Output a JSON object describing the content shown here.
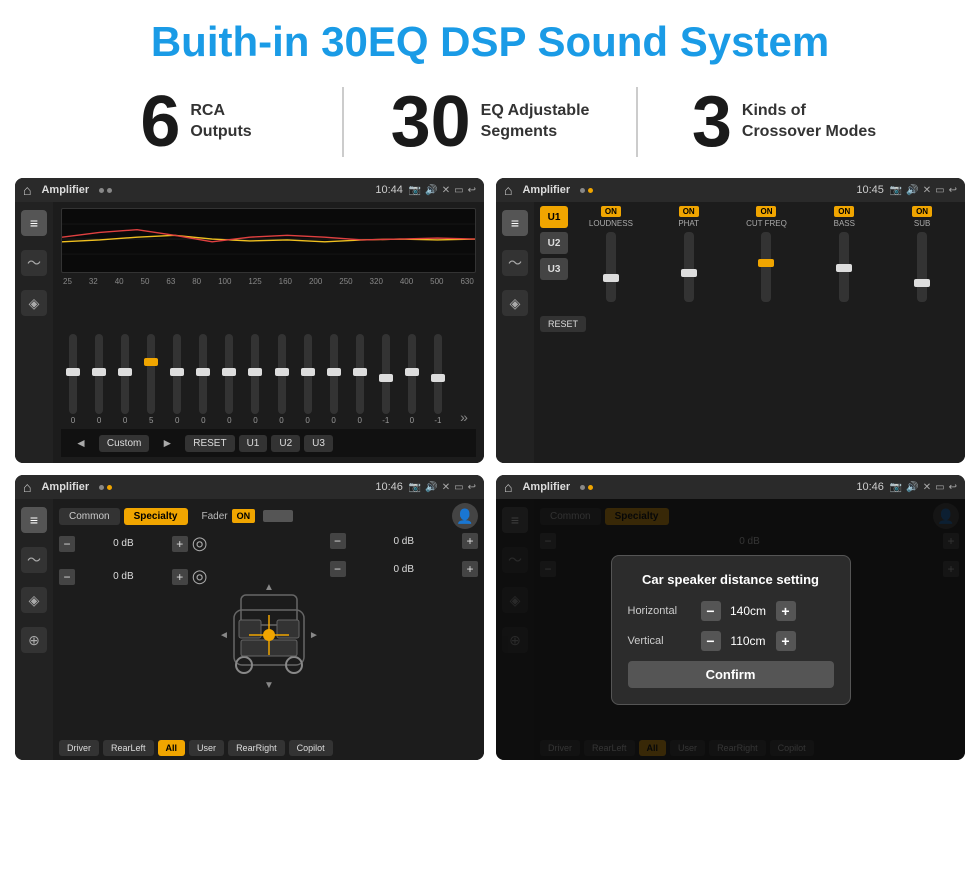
{
  "page": {
    "title": "Buith-in 30EQ DSP Sound System",
    "stats": [
      {
        "number": "6",
        "label_line1": "RCA",
        "label_line2": "Outputs"
      },
      {
        "number": "30",
        "label_line1": "EQ Adjustable",
        "label_line2": "Segments"
      },
      {
        "number": "3",
        "label_line1": "Kinds of",
        "label_line2": "Crossover Modes"
      }
    ]
  },
  "screen1": {
    "title": "Amplifier",
    "time": "10:44",
    "preset": "Custom",
    "buttons": [
      "◄",
      "Custom",
      "►",
      "RESET",
      "U1",
      "U2",
      "U3"
    ],
    "freqs": [
      "25",
      "32",
      "40",
      "50",
      "63",
      "80",
      "100",
      "125",
      "160",
      "200",
      "250",
      "320",
      "400",
      "500",
      "630"
    ],
    "values": [
      "0",
      "0",
      "0",
      "5",
      "0",
      "0",
      "0",
      "0",
      "0",
      "0",
      "0",
      "0",
      "-1",
      "0",
      "-1"
    ]
  },
  "screen2": {
    "title": "Amplifier",
    "time": "10:45",
    "uButtons": [
      "U1",
      "U2",
      "U3"
    ],
    "controls": [
      {
        "label": "LOUDNESS",
        "on": true
      },
      {
        "label": "PHAT",
        "on": true
      },
      {
        "label": "CUT FREQ",
        "on": true
      },
      {
        "label": "BASS",
        "on": true
      },
      {
        "label": "SUB",
        "on": true
      }
    ],
    "resetLabel": "RESET"
  },
  "screen3": {
    "title": "Amplifier",
    "time": "10:46",
    "tabs": [
      "Common",
      "Specialty"
    ],
    "faderLabel": "Fader",
    "faderOn": "ON",
    "dbValues": [
      "0 dB",
      "0 dB",
      "0 dB",
      "0 dB"
    ],
    "bottomButtons": [
      "Driver",
      "RearLeft",
      "All",
      "User",
      "RearRight",
      "Copilot"
    ]
  },
  "screen4": {
    "title": "Amplifier",
    "time": "10:46",
    "tabs": [
      "Common",
      "Specialty"
    ],
    "dialog": {
      "title": "Car speaker distance setting",
      "fields": [
        {
          "label": "Horizontal",
          "value": "140cm"
        },
        {
          "label": "Vertical",
          "value": "110cm"
        }
      ],
      "confirmLabel": "Confirm"
    },
    "dbValues": [
      "0 dB",
      "0 dB"
    ],
    "bottomButtons": [
      "Driver",
      "RearLeft",
      "All",
      "User",
      "RearRight",
      "Copilot"
    ]
  }
}
